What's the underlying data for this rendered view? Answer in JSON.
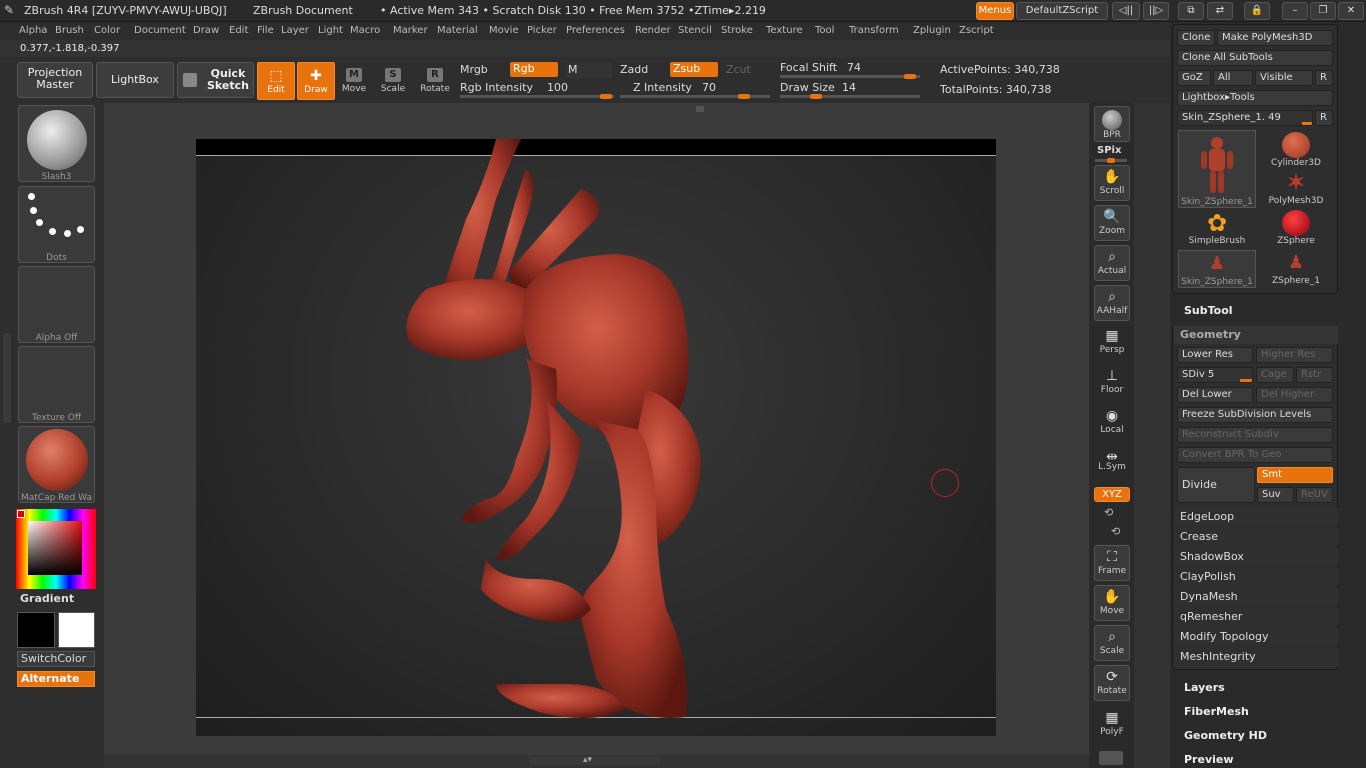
{
  "title": {
    "app": "ZBrush 4R4 [ZUYV-PMVY-AWUJ-UBQJ]",
    "doc": "ZBrush Document",
    "mem": "• Active Mem 343 • Scratch Disk 130 • Free Mem 3752 •ZTime▸2.219",
    "menus_btn": "Menus",
    "script_btn": "DefaultZScript"
  },
  "menubar": [
    "Alpha",
    "Brush",
    "Color",
    "Document",
    "Draw",
    "Edit",
    "File",
    "Layer",
    "Light",
    "Macro",
    "Marker",
    "Material",
    "Movie",
    "Picker",
    "Preferences",
    "Render",
    "Stencil",
    "Stroke",
    "Texture",
    "Tool",
    "Transform",
    "Zplugin",
    "Zscript"
  ],
  "coords": "0.377,-1.818,-0.397",
  "topshelf": {
    "projection_master": "Projection Master",
    "lightbox": "LightBox",
    "quick_sketch": "Quick Sketch",
    "edit": "Edit",
    "draw": "Draw",
    "move": "Move",
    "scale": "Scale",
    "rotate": "Rotate",
    "mrgb": "Mrgb",
    "rgb": "Rgb",
    "m": "M",
    "zadd": "Zadd",
    "zsub": "Zsub",
    "zcut": "Zcut",
    "rgb_intensity_label": "Rgb Intensity",
    "rgb_intensity": "100",
    "z_intensity_label": "Z Intensity",
    "z_intensity": "70",
    "focal_shift_label": "Focal Shift",
    "focal_shift": "74",
    "draw_size_label": "Draw Size",
    "draw_size": "14",
    "active_points": "ActivePoints: 340,738",
    "total_points": "TotalPoints: 340,738"
  },
  "leftshelf": {
    "brush": "Slash3",
    "stroke": "Dots",
    "alpha": "Alpha Off",
    "texture": "Texture Off",
    "material": "MatCap Red Wa",
    "gradient": "Gradient",
    "switch_color": "SwitchColor",
    "alternate": "Alternate"
  },
  "rightshelf": {
    "bpr": "BPR",
    "spix": "SPix",
    "scroll": "Scroll",
    "zoom": "Zoom",
    "actual": "Actual",
    "aahalf": "AAHalf",
    "persp": "Persp",
    "floor": "Floor",
    "local": "Local",
    "lsym": "L.Sym",
    "xyz": "XYZ",
    "frame": "Frame",
    "move": "Move",
    "scale": "Scale",
    "rotate": "Rotate",
    "polyf": "PolyF"
  },
  "toolpanel": {
    "clone": "Clone",
    "make_polymesh": "Make PolyMesh3D",
    "clone_all": "Clone All SubTools",
    "goz": "GoZ",
    "all": "All",
    "visible": "Visible",
    "r": "R",
    "lightbox_tools": "Lightbox▸Tools",
    "current_tool_name": "Skin_ZSphere_1.",
    "current_tool_value": "49",
    "tools": [
      {
        "name": "Skin_ZSphere_1",
        "icon": "red-figure-icon"
      },
      {
        "name": "Cylinder3D",
        "icon": "cylinder-icon"
      },
      {
        "name": "",
        "icon": ""
      },
      {
        "name": "PolyMesh3D",
        "icon": "star-icon"
      },
      {
        "name": "SimpleBrush",
        "icon": "simplebrush-icon"
      },
      {
        "name": "ZSphere",
        "icon": "zsphere-icon"
      },
      {
        "name": "Skin_ZSphere_1",
        "icon": "small-figure-icon"
      },
      {
        "name": "ZSphere_1",
        "icon": "small-figure-icon"
      }
    ],
    "subtool": "SubTool",
    "geometry": "Geometry",
    "lower_res": "Lower Res",
    "higher_res": "Higher Res",
    "sdiv": "SDiv 5",
    "cage": "Cage",
    "rstr": "Rstr",
    "del_lower": "Del Lower",
    "del_higher": "Del Higher",
    "freeze": "Freeze SubDivision Levels",
    "reconstruct": "Reconstruct Subdiv",
    "convert_bpr": "Convert BPR To Geo",
    "divide": "Divide",
    "smt": "Smt",
    "suv": "Suv",
    "reuv": "ReUV",
    "geo_items": [
      "EdgeLoop",
      "Crease",
      "ShadowBox",
      "ClayPolish",
      "DynaMesh",
      "qRemesher",
      "Modify Topology",
      "MeshIntegrity"
    ],
    "layers": "Layers",
    "fibermesh": "FiberMesh",
    "geometry_hd": "Geometry HD",
    "preview": "Preview"
  },
  "colors": {
    "accent": "#e8720c",
    "model": "#b0402c",
    "background": "#333333"
  }
}
